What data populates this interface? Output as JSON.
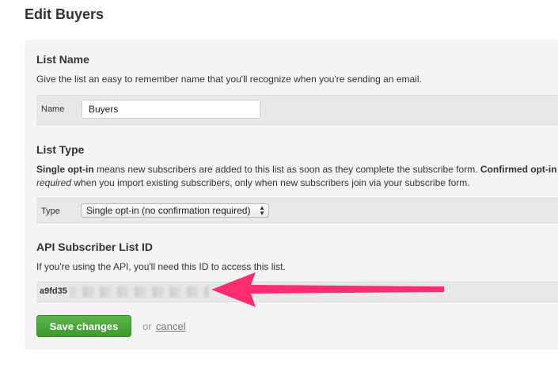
{
  "page_title": "Edit Buyers",
  "list_name": {
    "title": "List Name",
    "help": "Give the list an easy to remember name that you'll recognize when you're sending an email.",
    "field_label": "Name",
    "field_value": "Buyers"
  },
  "list_type": {
    "title": "List Type",
    "help_bold1": "Single opt-in",
    "help_part1": " means new subscribers are added to this list as soon as they complete the subscribe form. ",
    "help_bold2": "Confirmed opt-in",
    "help_italic": "required",
    "help_part2": " when you import existing subscribers, only when new subscribers join via your subscribe form.",
    "field_label": "Type",
    "selected_option": "Single opt-in (no confirmation required)"
  },
  "api": {
    "title": "API Subscriber List ID",
    "help": "If you're using the API, you'll need this ID to access this list.",
    "id_prefix": "a9fd35"
  },
  "actions": {
    "save_label": "Save changes",
    "or_text": "or",
    "cancel_label": "cancel"
  },
  "colors": {
    "save_button": "#4aa73a",
    "arrow": "#ff2d6f",
    "panel_bg": "#f4f4f4"
  }
}
